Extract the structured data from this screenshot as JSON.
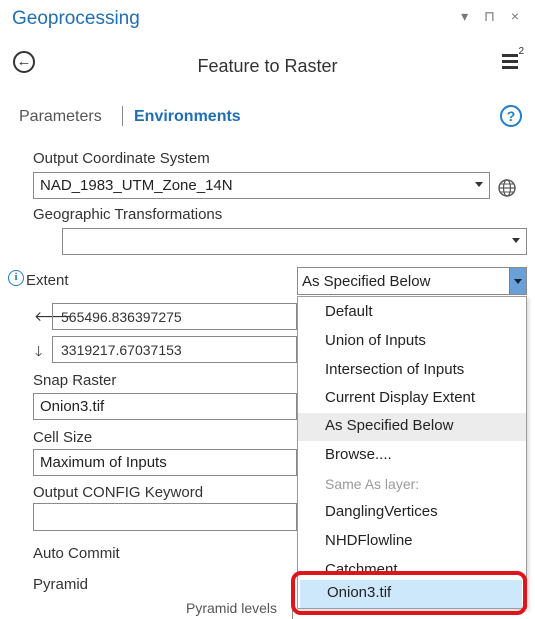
{
  "pane": {
    "title": "Geoprocessing",
    "controls": "▾ ⊓ ×"
  },
  "tool": {
    "title": "Feature to Raster",
    "back_icon": "back-arrow-icon",
    "menu_badge": "2"
  },
  "tabs": {
    "parameters": "Parameters",
    "environments": "Environments",
    "help": "?"
  },
  "environments": {
    "output_coord_label": "Output Coordinate System",
    "output_coord_value": "NAD_1983_UTM_Zone_14N",
    "geo_transform_label": "Geographic Transformations",
    "geo_transform_value": "",
    "extent_label": "Extent",
    "extent_value": "As Specified Below",
    "extent_left_value": "565496.836397275",
    "extent_bottom_value": "3319217.67037153",
    "snap_raster_label": "Snap Raster",
    "snap_raster_value": "Onion3.tif",
    "cell_size_label": "Cell Size",
    "cell_size_value": "Maximum of Inputs",
    "config_keyword_label": "Output CONFIG Keyword",
    "config_keyword_value": "",
    "auto_commit_label": "Auto Commit",
    "pyramid_label": "Pyramid",
    "pyramid_levels_label": "Pyramid levels"
  },
  "extent_dropdown": {
    "items": [
      "Default",
      "Union of Inputs",
      "Intersection of Inputs",
      "Current Display Extent",
      "As Specified Below",
      "Browse....",
      "Same As layer:",
      "DanglingVertices",
      "NHDFlowline",
      "Catchment",
      "Onion3.tif"
    ]
  },
  "colors": {
    "accent": "#1f6fb4",
    "highlight": "#cde8fa",
    "callout": "#e0141a"
  }
}
